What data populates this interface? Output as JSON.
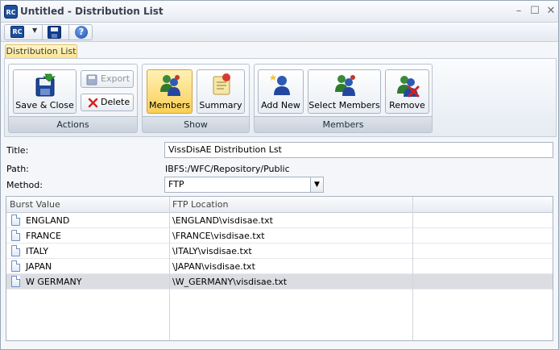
{
  "window": {
    "app_logo": "RC",
    "title": "Untitled - Distribution List",
    "controls": {
      "minimize": "–",
      "maximize": "☐",
      "close": "✕"
    }
  },
  "quick_access": {
    "logo": "RC",
    "dropdown_glyph": "▼",
    "help_glyph": "?"
  },
  "ribbon": {
    "tab_label": "Distribution List",
    "groups": {
      "actions": {
        "label": "Actions",
        "save_close": "Save & Close",
        "export": "Export",
        "delete": "Delete"
      },
      "show": {
        "label": "Show",
        "members": "Members",
        "summary": "Summary"
      },
      "members": {
        "label": "Members",
        "add_new": "Add New",
        "select_members": "Select Members",
        "remove": "Remove"
      }
    }
  },
  "form": {
    "title_label": "Title:",
    "title_value": "VissDisAE Distribution Lst",
    "path_label": "Path:",
    "path_value": "IBFS:/WFC/Repository/Public",
    "method_label": "Method:",
    "method_value": "FTP",
    "method_arrow": "▼"
  },
  "grid": {
    "columns": [
      "Burst Value",
      "FTP Location"
    ],
    "rows": [
      {
        "burst": "ENGLAND",
        "location": "\\ENGLAND\\visdisae.txt"
      },
      {
        "burst": "FRANCE",
        "location": "\\FRANCE\\visdisae.txt"
      },
      {
        "burst": "ITALY",
        "location": "\\ITALY\\visdisae.txt"
      },
      {
        "burst": "JAPAN",
        "location": "\\JAPAN\\visdisae.txt"
      },
      {
        "burst": "W GERMANY",
        "location": "\\W_GERMANY\\visdisae.txt"
      }
    ],
    "selected_row": 4
  },
  "colors": {
    "active_button": "#f9cf55",
    "selected_row": "#dcdde2",
    "delete_x": "#d42020"
  }
}
